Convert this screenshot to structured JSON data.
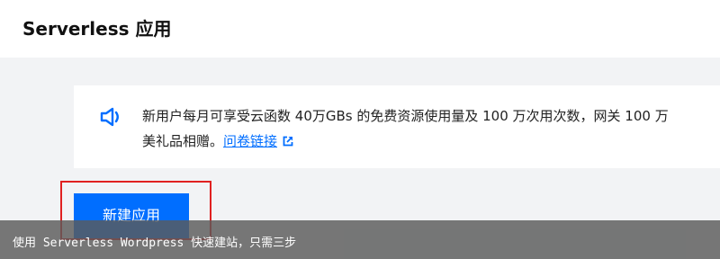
{
  "header": {
    "title": "Serverless 应用"
  },
  "notice": {
    "icon": "speaker-icon",
    "line1": "新用户每月可享受云函数 40万GBs 的免费资源使用量及 100 万次用次数，网关 100 万",
    "line2_prefix": "美礼品相赠。",
    "link_label": "问卷链接",
    "link_icon": "external-link-icon"
  },
  "actions": {
    "create_label": "新建应用"
  },
  "caption": {
    "text": "使用 Serverless Wordpress 快速建站，只需三步"
  },
  "colors": {
    "accent": "#006eff",
    "highlight": "#e02020",
    "background": "#f2f3f5"
  }
}
